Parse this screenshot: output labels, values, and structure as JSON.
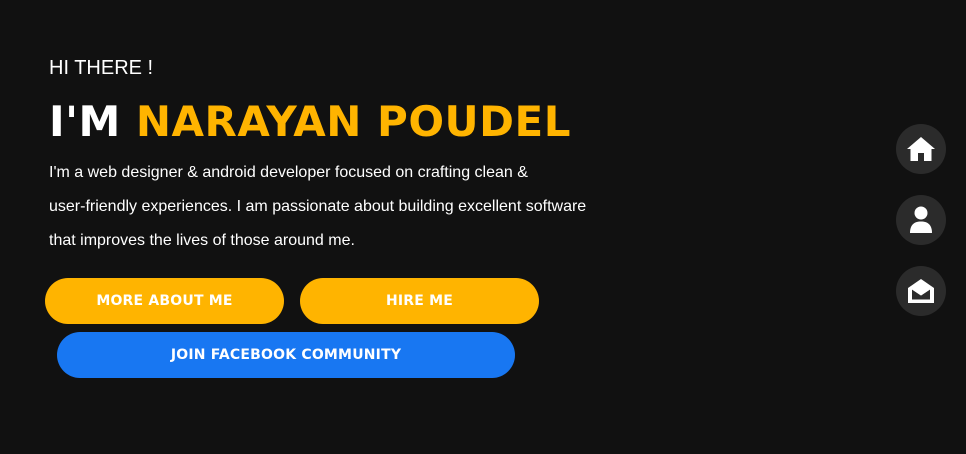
{
  "hero": {
    "greeting": "HI THERE !",
    "name_prefix": "I'M",
    "name": "NARAYAN POUDEL",
    "intro_lines": [
      "I'm a web designer & android developer focused on crafting clean &",
      "user-friendly experiences. I am passionate about building excellent software",
      "that improves the lives of those around me."
    ]
  },
  "buttons": {
    "more_about": "MORE ABOUT ME",
    "hire": "HIRE ME",
    "facebook": "JOIN FACEBOOK COMMUNITY"
  },
  "side_nav": {
    "items": [
      {
        "icon": "home-icon"
      },
      {
        "icon": "user-icon"
      },
      {
        "icon": "envelope-open-icon"
      }
    ]
  },
  "colors": {
    "background": "#111111",
    "accent": "#ffb400",
    "facebook": "#1877f2",
    "nav_circle": "#2b2b2b",
    "text": "#ffffff"
  }
}
